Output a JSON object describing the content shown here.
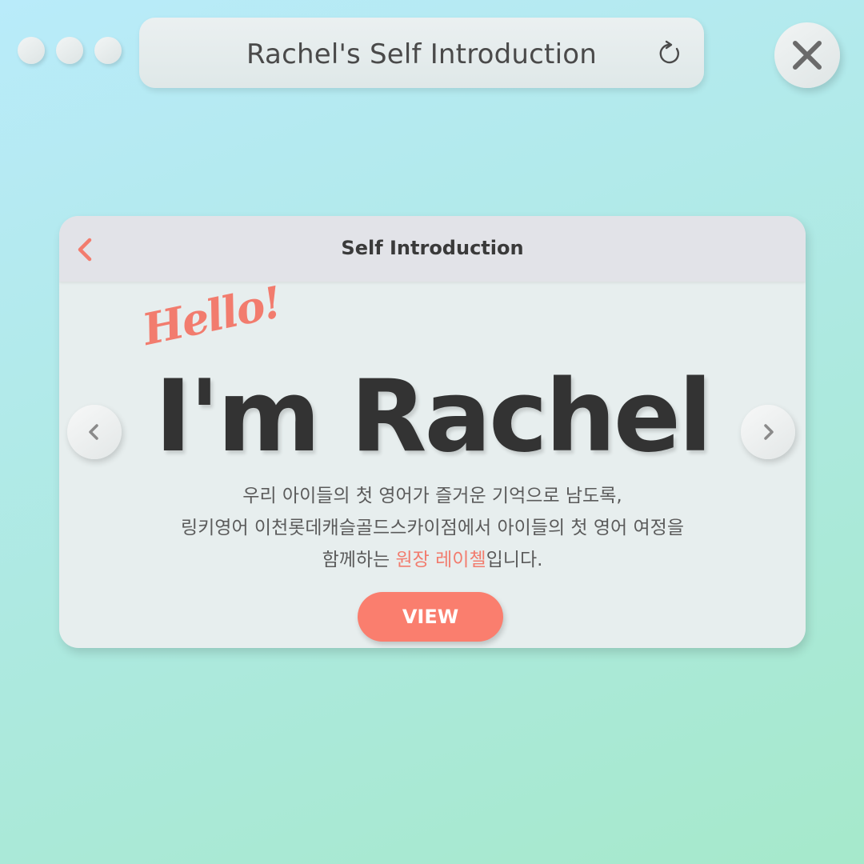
{
  "window": {
    "title": "Rachel's Self Introduction",
    "controls": [
      "window-dot",
      "window-dot",
      "window-dot"
    ]
  },
  "card": {
    "header_title": "Self Introduction",
    "greeting": "Hello!",
    "headline": "I'm Rachel",
    "description": {
      "line1": "우리 아이들의 첫 영어가 즐거운 기억으로 남도록,",
      "line2": "링키영어 이천롯데캐슬골드스카이점에서 아이들의 첫 영어 여정을",
      "line3_prefix": "함께하는 ",
      "line3_highlight": "원장 레이첼",
      "line3_suffix": "입니다."
    },
    "view_label": "VIEW"
  },
  "icons": {
    "refresh": "refresh-icon",
    "close": "close-icon",
    "back": "chevron-left-icon",
    "prev": "chevron-left-icon",
    "next": "chevron-right-icon"
  },
  "colors": {
    "accent": "#fa7e6e",
    "highlight_text": "#f27c6e",
    "headline": "#333333",
    "body_text": "#5b5b5b"
  }
}
